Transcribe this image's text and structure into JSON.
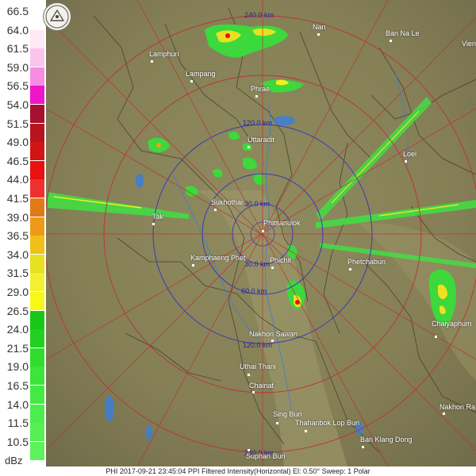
{
  "legend": {
    "unit": "dBz",
    "levels": [
      {
        "value": "66.5",
        "color": "#ffffff"
      },
      {
        "value": "64.0",
        "color": "#fde9f6"
      },
      {
        "value": "61.5",
        "color": "#fbc4ee"
      },
      {
        "value": "59.0",
        "color": "#f78ce4"
      },
      {
        "value": "56.5",
        "color": "#ee16c8"
      },
      {
        "value": "54.0",
        "color": "#a81030"
      },
      {
        "value": "51.5",
        "color": "#b8141e"
      },
      {
        "value": "49.0",
        "color": "#d21414"
      },
      {
        "value": "46.5",
        "color": "#e81010"
      },
      {
        "value": "44.0",
        "color": "#f03030"
      },
      {
        "value": "41.5",
        "color": "#e07a18"
      },
      {
        "value": "39.0",
        "color": "#ee9a18"
      },
      {
        "value": "36.5",
        "color": "#f0c018"
      },
      {
        "value": "34.0",
        "color": "#e6e020"
      },
      {
        "value": "31.5",
        "color": "#f4f030"
      },
      {
        "value": "29.0",
        "color": "#f8f818"
      },
      {
        "value": "26.5",
        "color": "#18c818"
      },
      {
        "value": "24.0",
        "color": "#22d022"
      },
      {
        "value": "21.5",
        "color": "#30dc30"
      },
      {
        "value": "19.0",
        "color": "#3ce43c"
      },
      {
        "value": "16.5",
        "color": "#44ea44"
      },
      {
        "value": "14.0",
        "color": "#4cee4c"
      },
      {
        "value": "11.5",
        "color": "#54f054"
      },
      {
        "value": "10.5",
        "color": "#5cf25c"
      }
    ]
  },
  "rings": {
    "r30": "30.0 km",
    "r60": "60.0 km",
    "r120": "120.0 km",
    "r180": "180.0 km",
    "r240": "240.0 km"
  },
  "cities": {
    "lamphun": "Lamphun",
    "lampang": "Lampang",
    "nan": "Nan",
    "ban_na_le": "Ban Na Le",
    "vien": "Vien",
    "phrae": "Phrae",
    "uttaradit": "Uttaradit",
    "loei": "Loei",
    "sukhothai": "Sukhothai",
    "tak": "Tak",
    "phitsanulok": "Phitsanulok",
    "kamphaeng_phet": "Kamphaeng Phet",
    "phichit": "Phichit",
    "phetchabun": "Phetchabun",
    "chaiyaphum": "Chaiyaphum",
    "nakhon_sawan": "Nakhon Sawan",
    "uthai_thani": "Uthai Thani",
    "chainat": "Chainat",
    "nakhon_ra": "Nakhon Ra",
    "sing_buri": "Sing Buri",
    "thahanbok": "Thahanbok Lop Buri",
    "ban_klang_dong": "Ban Klang Dong",
    "suphan_buri": "Suphan Buri"
  },
  "footer": "PHI 2017-09-21 23:45:04 PPI Filtered Intensity(Horizontal)  El: 0.50°  Sweep: 1 Polar"
}
